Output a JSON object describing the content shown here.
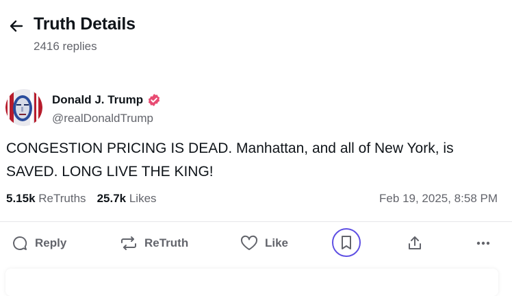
{
  "header": {
    "title": "Truth Details",
    "replies": "2416 replies"
  },
  "post": {
    "author_name": "Donald J. Trump",
    "handle": "@realDonaldTrump",
    "text": "CONGESTION PRICING IS DEAD. Manhattan, and all of New York, is SAVED. LONG LIVE THE KING!",
    "retruths_count": "5.15k",
    "retruths_label": "ReTruths",
    "likes_count": "25.7k",
    "likes_label": "Likes",
    "date": "Feb 19, 2025, 8:58 PM"
  },
  "actions": {
    "reply": "Reply",
    "retruth": "ReTruth",
    "like": "Like"
  },
  "colors": {
    "verified": "#e84b72",
    "bookmark_focus": "#5e4fe3",
    "muted_text": "#62646b"
  }
}
